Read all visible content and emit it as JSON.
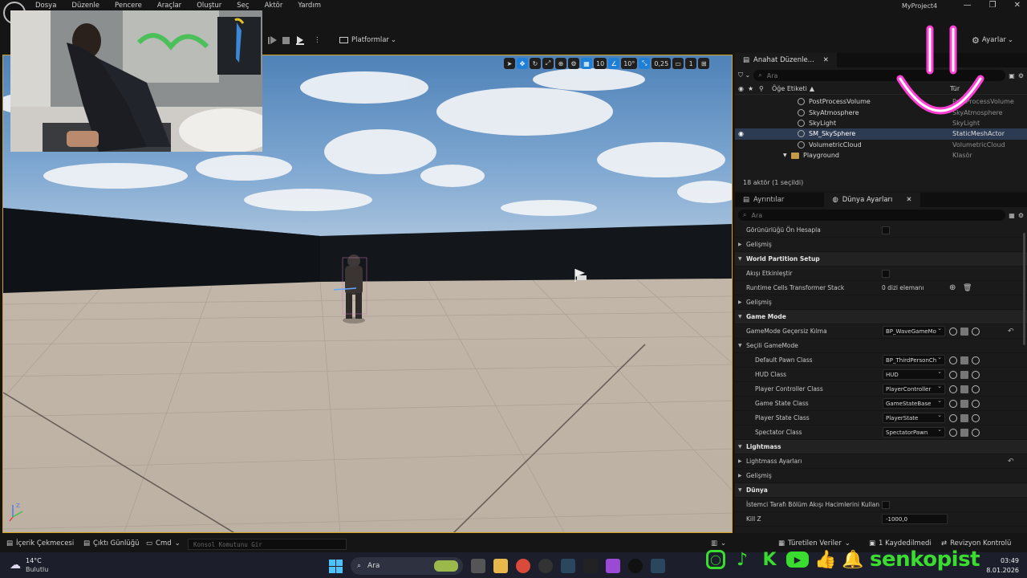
{
  "menubar": {
    "items": [
      "Dosya",
      "Düzenle",
      "Pencere",
      "Araçlar",
      "Oluştur",
      "Seç",
      "Aktör",
      "Yardım"
    ],
    "project": "MyProject4",
    "window_controls": [
      "—",
      "❐",
      "✕"
    ]
  },
  "toolbar": {
    "platforms_label": "Platformlar",
    "settings_label": "Ayarlar"
  },
  "viewport": {
    "grid_snap": "10",
    "rotation_snap": "10°",
    "scale_snap": "0,25",
    "camera_speed": "1"
  },
  "outliner": {
    "tab_label": "Anahat Düzenle...",
    "search_placeholder": "Ara",
    "col_label": "Öğe Etiketi",
    "col_type": "Tür",
    "rows": [
      {
        "label": "PostProcessVolume",
        "type": "PostProcessVolume"
      },
      {
        "label": "SkyAtmosphere",
        "type": "SkyAtmosphere"
      },
      {
        "label": "SkyLight",
        "type": "SkyLight"
      },
      {
        "label": "SM_SkySphere",
        "type": "StaticMeshActor"
      },
      {
        "label": "VolumetricCloud",
        "type": "VolumetricCloud"
      },
      {
        "label": "Playground",
        "type": "Klasör"
      }
    ],
    "status": "18 aktör (1 seçildi)"
  },
  "details": {
    "tab_details": "Ayrıntılar",
    "tab_world": "Dünya Ayarları",
    "search_placeholder": "Ara",
    "precompute_vis": "Görünürlüğü Ön Hesapla",
    "advanced": "Gelişmiş",
    "wp_section": "World Partition Setup",
    "enable_streaming": "Akışı Etkinleştir",
    "runtime_cells": "Runtime Cells Transformer Stack",
    "runtime_cells_val": "0 dizi elemanı",
    "gamemode_section": "Game Mode",
    "gamemode_override": "GameMode Geçersiz Kılma",
    "gamemode_override_val": "BP_WaveGameMo",
    "selected_gamemode": "Seçili GameMode",
    "classes": [
      {
        "label": "Default Pawn Class",
        "value": "BP_ThirdPersonCh"
      },
      {
        "label": "HUD Class",
        "value": "HUD"
      },
      {
        "label": "Player Controller Class",
        "value": "PlayerController"
      },
      {
        "label": "Game State Class",
        "value": "GameStateBase"
      },
      {
        "label": "Player State Class",
        "value": "PlayerState"
      },
      {
        "label": "Spectator Class",
        "value": "SpectatorPawn"
      }
    ],
    "lightmass_section": "Lightmass",
    "lightmass_settings": "Lightmass Ayarları",
    "world_section": "Dünya",
    "client_streaming": "İstemci Tarafı Bölüm Akışı Hacimlerini Kullan",
    "kill_z": "Kill Z",
    "kill_z_val": "-1000,0"
  },
  "statusbar": {
    "content_drawer": "İçerik Çekmecesi",
    "output_log": "Çıktı Günlüğü",
    "cmd": "Cmd",
    "console_placeholder": "Konsol Komutunu Gir",
    "derived_data": "Türetilen Veriler",
    "unsaved": "1 Kaydedilmedi",
    "revision": "Revizyon Kontrolü"
  },
  "taskbar": {
    "temperature": "14°C",
    "weather": "Bulutlu",
    "search": "Ara",
    "time": "03:49",
    "date": "8.01.2026"
  },
  "overlay": {
    "handle": "senkopist",
    "colors": {
      "green": "#3bdc30",
      "pink": "#ff3fd6"
    }
  }
}
